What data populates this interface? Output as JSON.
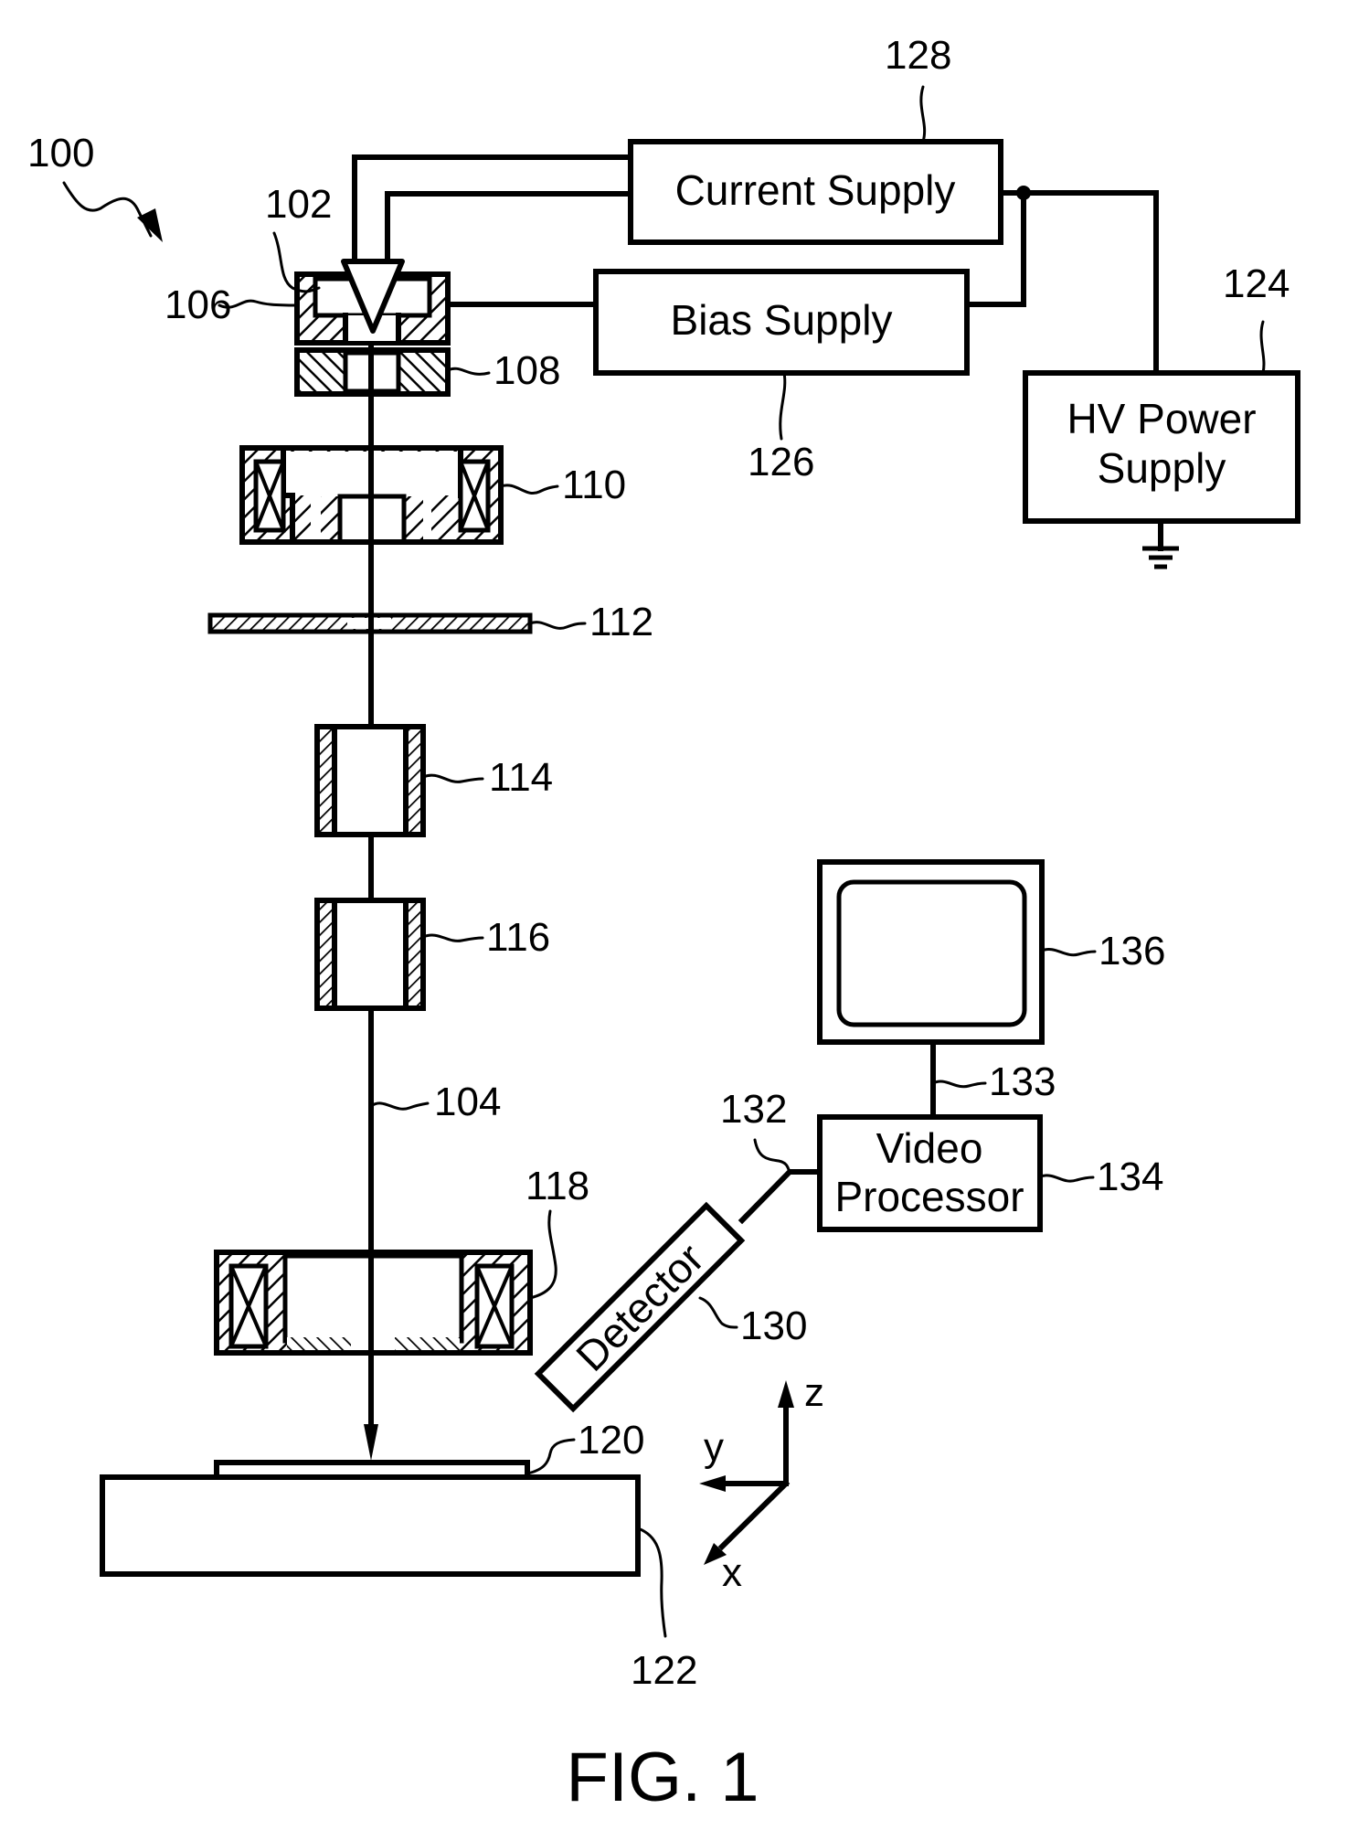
{
  "figure": {
    "caption": "FIG. 1",
    "system_ref": "100"
  },
  "components": {
    "emitter": {
      "ref": "102"
    },
    "beam": {
      "ref": "104"
    },
    "suppressor_electrode": {
      "ref": "106"
    },
    "extractor_electrode": {
      "ref": "108"
    },
    "condenser_lens": {
      "ref": "110"
    },
    "aperture": {
      "ref": "112"
    },
    "deflector_upper": {
      "ref": "114"
    },
    "deflector_lower": {
      "ref": "116"
    },
    "objective_lens": {
      "ref": "118"
    },
    "sample": {
      "ref": "120"
    },
    "stage": {
      "ref": "122"
    },
    "hv_power_supply": {
      "ref": "124",
      "label_line1": "HV Power",
      "label_line2": "Supply"
    },
    "bias_supply": {
      "ref": "126",
      "label": "Bias Supply"
    },
    "current_supply": {
      "ref": "128",
      "label": "Current Supply"
    },
    "detector": {
      "ref": "130",
      "label": "Detector"
    },
    "detector_signal_line": {
      "ref": "132"
    },
    "monitor_link": {
      "ref": "133"
    },
    "video_processor": {
      "ref": "134",
      "label_line1": "Video",
      "label_line2": "Processor"
    },
    "monitor": {
      "ref": "136"
    }
  },
  "axes": {
    "z": "z",
    "y": "y",
    "x": "x"
  }
}
